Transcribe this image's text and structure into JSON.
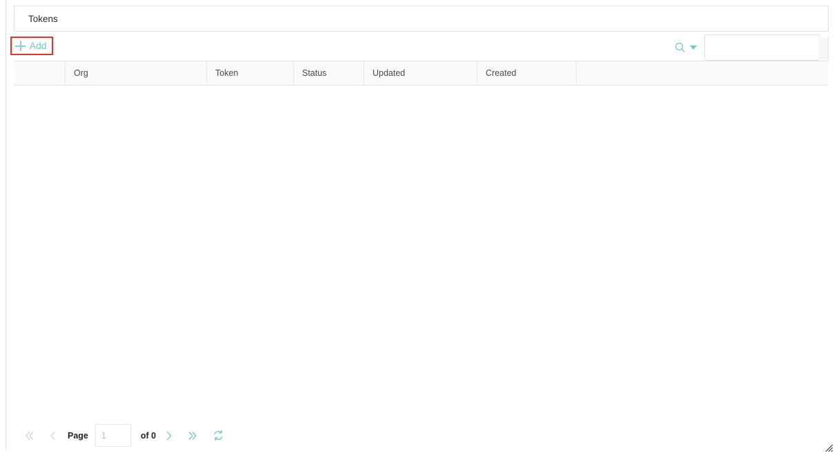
{
  "window": {
    "tab_label": "Tokens"
  },
  "toolbar": {
    "add_label": "Add",
    "add_icon": "plus-icon",
    "add_highlight_color": "#e8322a",
    "accent_color": "#6ec5c9",
    "search_icon": "search-icon",
    "search_dropdown_icon": "chevron-down-icon",
    "search_value": "",
    "search_placeholder": ""
  },
  "grid": {
    "columns": [
      {
        "label": "",
        "name": "row-select"
      },
      {
        "label": "Org",
        "name": "org"
      },
      {
        "label": "Token",
        "name": "token"
      },
      {
        "label": "Status",
        "name": "status"
      },
      {
        "label": "Updated",
        "name": "updated"
      },
      {
        "label": "Created",
        "name": "created"
      },
      {
        "label": "",
        "name": "filler"
      }
    ],
    "rows": []
  },
  "pager": {
    "first_icon": "double-chevron-left-icon",
    "prev_icon": "chevron-left-icon",
    "page_label": "Page",
    "page_value": "1",
    "of_label": "of 0",
    "next_icon": "chevron-right-icon",
    "last_icon": "double-chevron-right-icon",
    "refresh_icon": "refresh-icon",
    "disabled_color": "#d5d5d5",
    "enabled_color": "#7ac6ca"
  }
}
